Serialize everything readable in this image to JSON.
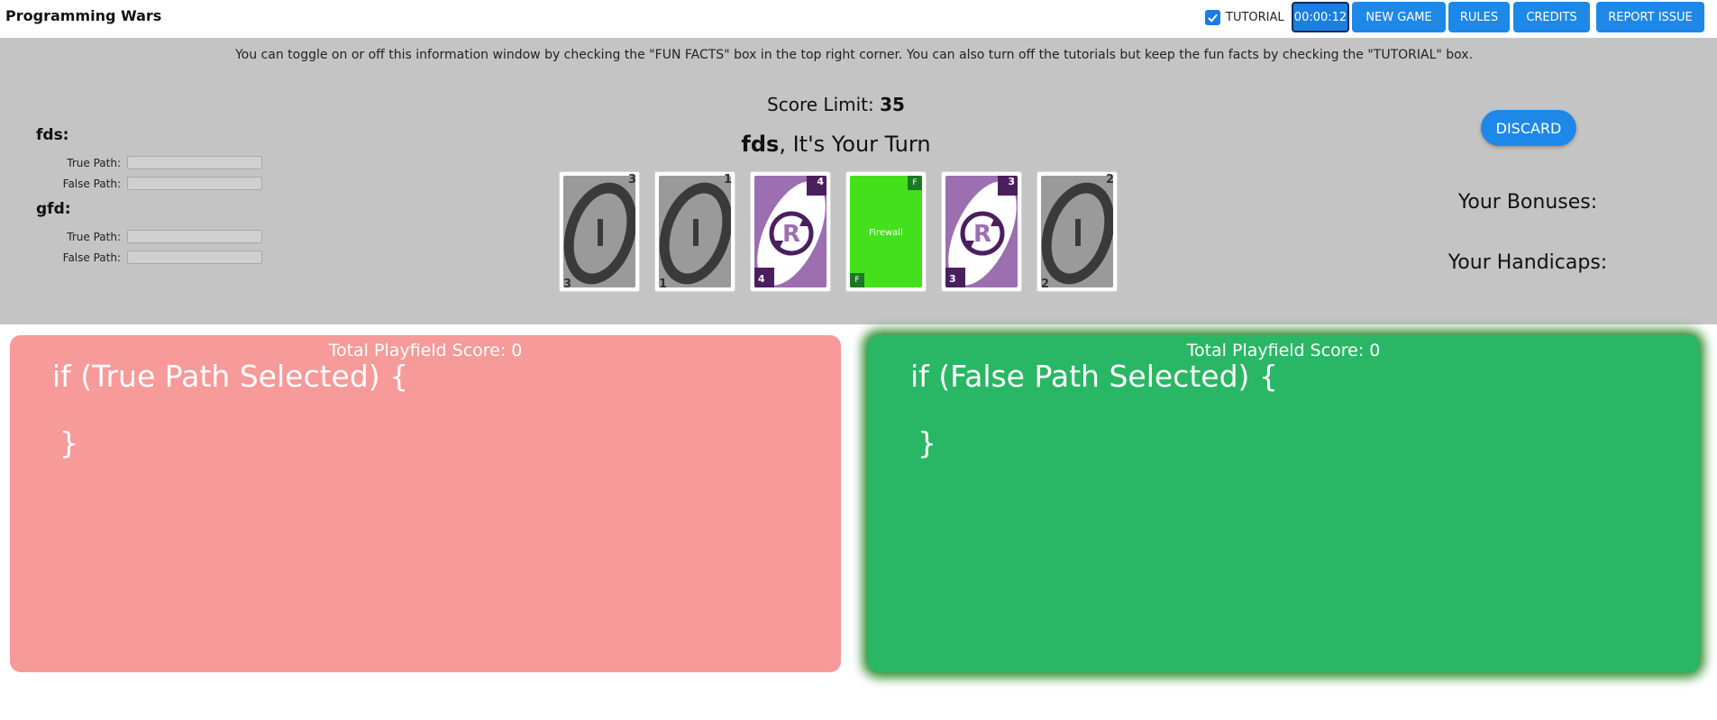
{
  "header": {
    "app_title": "Programming Wars",
    "tutorial_label": "TUTORIAL",
    "tutorial_checked": true,
    "timer": "00:00:12",
    "buttons": {
      "new_game": "NEW GAME",
      "rules": "RULES",
      "credits": "CREDITS",
      "report_issue": "REPORT ISSUE"
    },
    "accent_color": "#1e88e8"
  },
  "info": {
    "tip": "You can toggle on or off this information window by checking the \"FUN FACTS\" box in the top right corner. You can also turn off the tutorials but keep the fun facts by checking the \"TUTORIAL\" box."
  },
  "players": [
    {
      "name": "fds:",
      "true_path_label": "True Path:",
      "false_path_label": "False Path:"
    },
    {
      "name": "gfd:",
      "true_path_label": "True Path:",
      "false_path_label": "False Path:"
    }
  ],
  "game": {
    "score_limit_label": "Score Limit: ",
    "score_limit_value": "35",
    "current_player": "fds",
    "turn_suffix": ", It's Your Turn",
    "discard_label": "DISCARD",
    "bonuses_label": "Your Bonuses:",
    "handicaps_label": "Your Handicaps:"
  },
  "hand": [
    {
      "type": "instruction",
      "icon": "instruction-icon",
      "value": "3"
    },
    {
      "type": "instruction",
      "icon": "instruction-icon",
      "value": "1"
    },
    {
      "type": "repetition",
      "icon": "repetition-icon",
      "value": "4"
    },
    {
      "type": "firewall",
      "label": "Firewall",
      "badge": "F"
    },
    {
      "type": "repetition",
      "icon": "repetition-icon",
      "value": "3"
    },
    {
      "type": "instruction",
      "icon": "instruction-icon",
      "value": "2"
    }
  ],
  "playfields": {
    "true": {
      "score": "Total Playfield Score: 0",
      "condition": "if (True Path Selected) {",
      "close": "}",
      "color": "#f79a9a"
    },
    "false": {
      "score": "Total Playfield Score: 0",
      "condition": "if (False Path Selected) {",
      "close": "}",
      "color": "#2ab765"
    }
  }
}
